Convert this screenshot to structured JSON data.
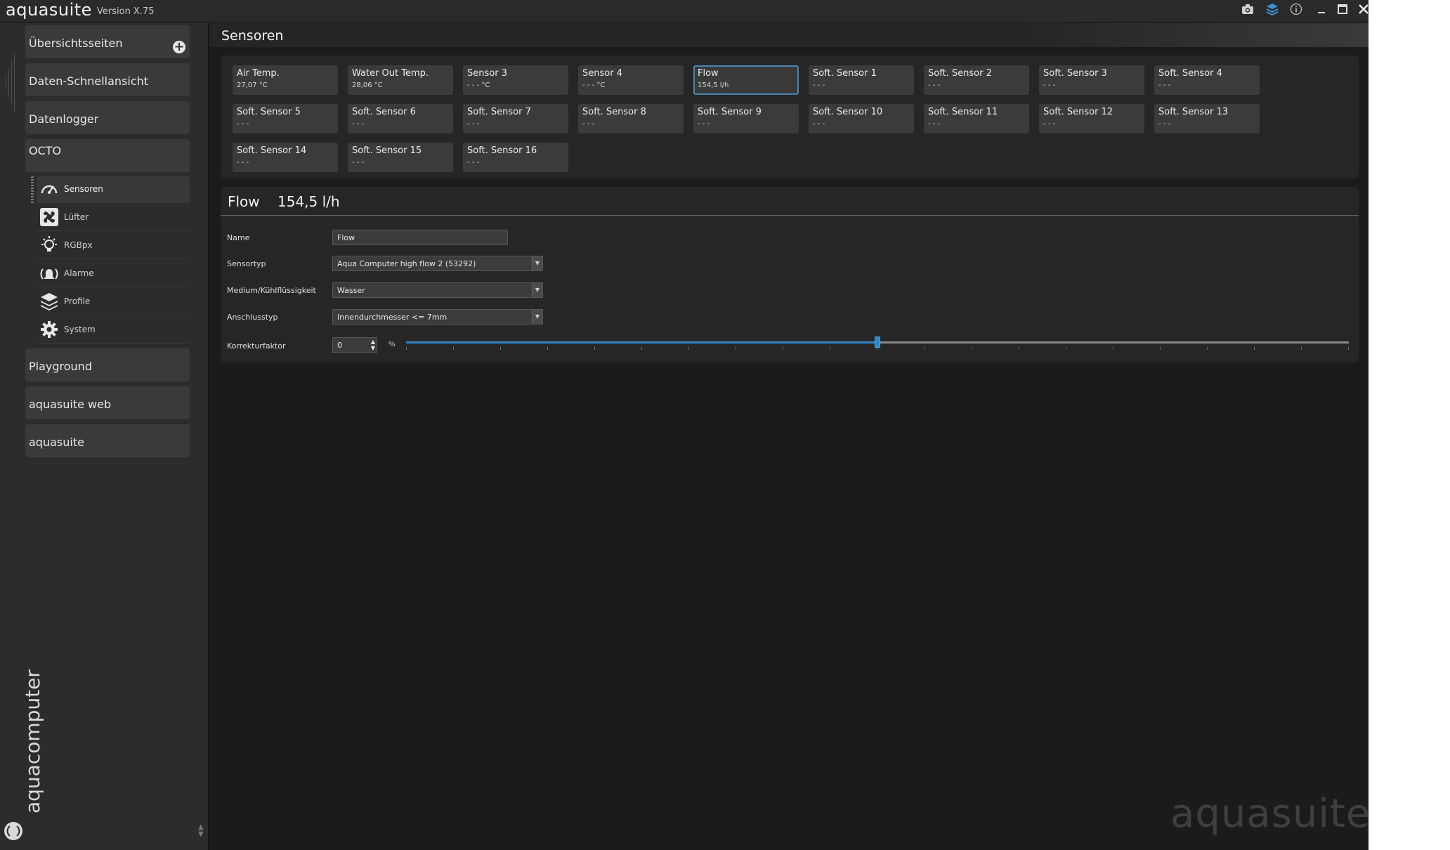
{
  "app": {
    "name": "aquasuite",
    "version": "Version X.75",
    "watermark": "aquasuite",
    "brand": "aquacomputer"
  },
  "sidebar": {
    "groups": [
      {
        "label": "Übersichtsseiten",
        "icon": "plus-circle-icon"
      },
      {
        "label": "Daten-Schnellansicht"
      },
      {
        "label": "Datenlogger"
      },
      {
        "label": "OCTO"
      }
    ],
    "octo_items": [
      {
        "label": "Sensoren",
        "icon": "gauge-icon",
        "active": true
      },
      {
        "label": "Lüfter",
        "icon": "fan-icon"
      },
      {
        "label": "RGBpx",
        "icon": "lightbulb-icon"
      },
      {
        "label": "Alarme",
        "icon": "alarm-icon"
      },
      {
        "label": "Profile",
        "icon": "layers-icon"
      },
      {
        "label": "System",
        "icon": "gear-icon"
      }
    ],
    "bottom_groups": [
      {
        "label": "Playground"
      },
      {
        "label": "aquasuite web"
      },
      {
        "label": "aquasuite"
      }
    ]
  },
  "page": {
    "title": "Sensoren"
  },
  "sensors": [
    {
      "name": "Air Temp.",
      "value": "27,07 °C"
    },
    {
      "name": "Water Out Temp.",
      "value": "28,06 °C"
    },
    {
      "name": "Sensor 3",
      "value": "- - - °C"
    },
    {
      "name": "Sensor 4",
      "value": "- - - °C"
    },
    {
      "name": "Flow",
      "value": "154,5 l/h",
      "selected": true
    },
    {
      "name": "Soft. Sensor 1",
      "value": "- - -"
    },
    {
      "name": "Soft. Sensor 2",
      "value": "- - -"
    },
    {
      "name": "Soft. Sensor 3",
      "value": "- - -"
    },
    {
      "name": "Soft. Sensor 4",
      "value": "- - -"
    },
    {
      "name": "Soft. Sensor 5",
      "value": "- - -"
    },
    {
      "name": "Soft. Sensor 6",
      "value": "- - -"
    },
    {
      "name": "Soft. Sensor 7",
      "value": "- - -"
    },
    {
      "name": "Soft. Sensor 8",
      "value": "- - -"
    },
    {
      "name": "Soft. Sensor 9",
      "value": "- - -"
    },
    {
      "name": "Soft. Sensor 10",
      "value": "- - -"
    },
    {
      "name": "Soft. Sensor 11",
      "value": "- - -"
    },
    {
      "name": "Soft. Sensor 12",
      "value": "- - -"
    },
    {
      "name": "Soft. Sensor 13",
      "value": "- - -"
    },
    {
      "name": "Soft. Sensor 14",
      "value": "- - -"
    },
    {
      "name": "Soft. Sensor 15",
      "value": "- - -"
    },
    {
      "name": "Soft. Sensor 16",
      "value": "- - -"
    }
  ],
  "detail": {
    "name": "Flow",
    "value": "154,5 l/h",
    "fields": {
      "name_label": "Name",
      "name_value": "Flow",
      "sensortyp_label": "Sensortyp",
      "sensortyp_value": "Aqua Computer high flow 2 (53292)",
      "medium_label": "Medium/Kühlflüssigkeit",
      "medium_value": "Wasser",
      "anschluss_label": "Anschlusstyp",
      "anschluss_value": "Innendurchmesser <= 7mm",
      "korrektur_label": "Korrekturfaktor",
      "korrektur_value": "0",
      "korrektur_unit": "%"
    },
    "slider": {
      "value_fraction": 0.5,
      "ticks": 21
    }
  },
  "colors": {
    "accent": "#2f86c6",
    "selected_border": "#4a86b0",
    "background": "#1b1b1b",
    "panel": "#262626",
    "tile": "#3b3b3b"
  }
}
